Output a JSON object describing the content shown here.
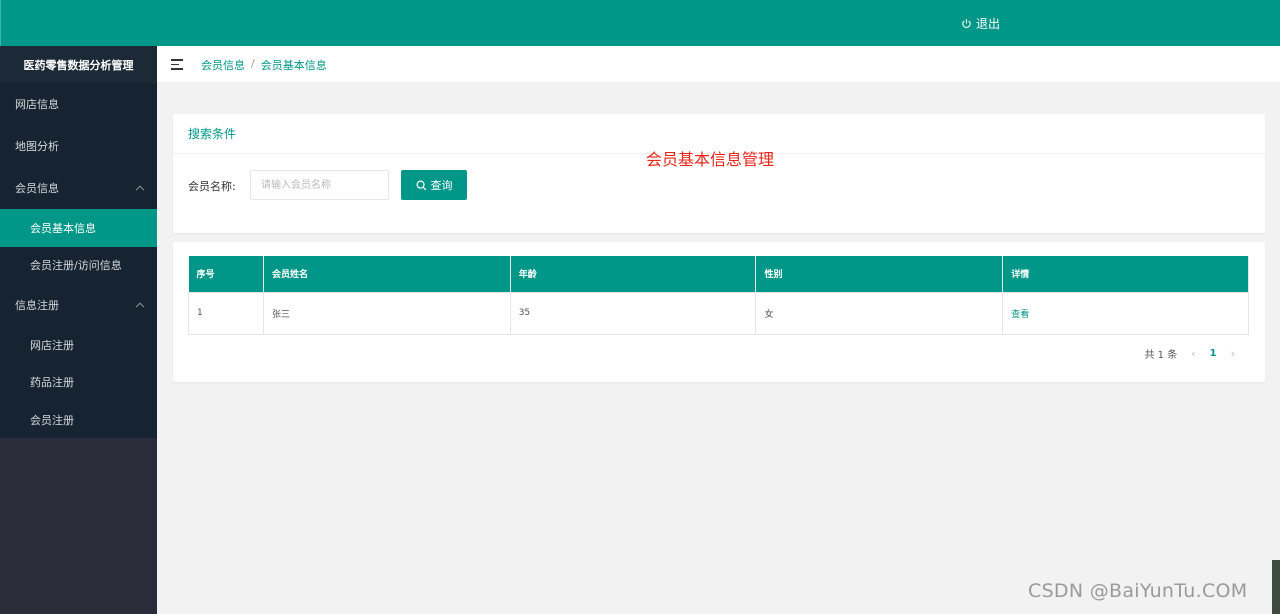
{
  "header": {
    "logout_label": "退出"
  },
  "sidebar": {
    "title": "医药零售数据分析管理",
    "items": [
      {
        "label": "网店信息"
      },
      {
        "label": "地图分析"
      },
      {
        "label": "会员信息",
        "children": [
          {
            "label": "会员基本信息"
          },
          {
            "label": "会员注册/访问信息"
          }
        ]
      },
      {
        "label": "信息注册",
        "children": [
          {
            "label": "网店注册"
          },
          {
            "label": "药品注册"
          },
          {
            "label": "会员注册"
          }
        ]
      }
    ]
  },
  "breadcrumb": {
    "parent": "会员信息",
    "separator": "/",
    "current": "会员基本信息"
  },
  "search": {
    "card_title": "搜索条件",
    "page_heading": "会员基本信息管理",
    "label": "会员名称:",
    "placeholder": "请输入会员名称",
    "value": "",
    "button_label": "查询"
  },
  "table": {
    "columns": [
      "序号",
      "会员姓名",
      "年龄",
      "性别",
      "详情"
    ],
    "rows": [
      [
        "1",
        "张三",
        "35",
        "女",
        "查看"
      ]
    ]
  },
  "pagination": {
    "total_text": "共 1 条",
    "current_page": "1"
  },
  "watermark": "CSDN @BaiYunTu.COM",
  "colors": {
    "accent": "#009688",
    "sidebar": "#152430",
    "heading": "#e8261a"
  }
}
